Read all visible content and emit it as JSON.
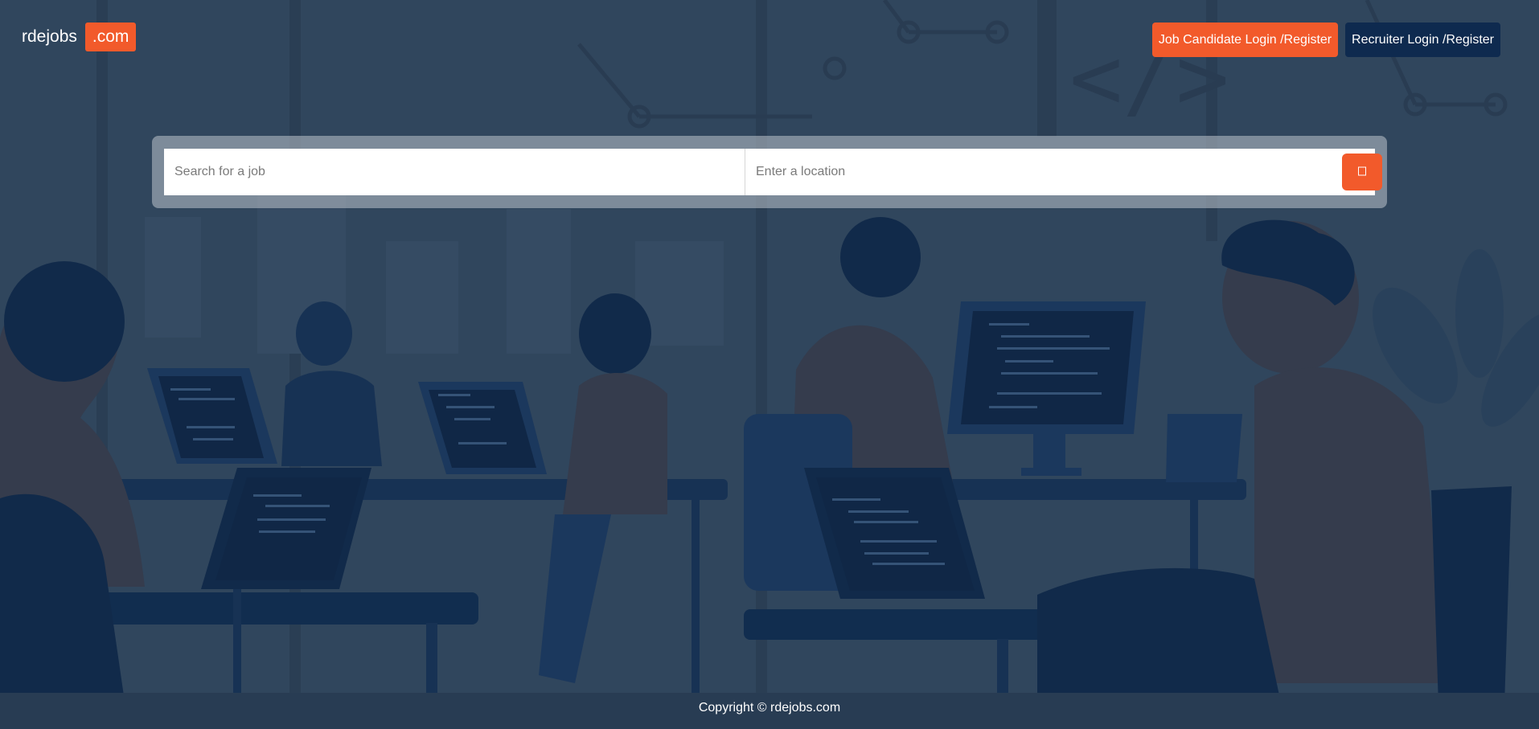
{
  "header": {
    "logo_text": "rdejobs",
    "logo_badge": ".com",
    "candidate_button": "Job Candidate Login /Register",
    "recruiter_button": "Recruiter Login /Register"
  },
  "search": {
    "job_placeholder": "Search for a job",
    "job_value": "",
    "location_placeholder": "Enter a location",
    "location_value": "",
    "button_icon": "search-icon"
  },
  "footer": {
    "copyright": "Copyright © rdejobs.com"
  },
  "colors": {
    "accent": "#f25a2b",
    "navy": "#0e2a4f",
    "background": "#2f4258"
  }
}
